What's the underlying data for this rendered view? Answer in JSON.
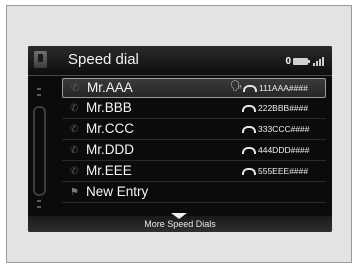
{
  "header": {
    "title": "Speed dial",
    "status_number": "0",
    "phone_icon": "phone-tab-icon",
    "battery_icon": "battery-icon",
    "signal_icon": "signal-icon"
  },
  "entries": [
    {
      "name": "Mr.AAA",
      "number": "111AAA####",
      "voice_tag": true
    },
    {
      "name": "Mr.BBB",
      "number": "222BBB####",
      "voice_tag": false
    },
    {
      "name": "Mr.CCC",
      "number": "333CCC####",
      "voice_tag": false
    },
    {
      "name": "Mr.DDD",
      "number": "444DDD####",
      "voice_tag": false
    },
    {
      "name": "Mr.EEE",
      "number": "555EEE####",
      "voice_tag": false
    }
  ],
  "new_entry_label": "New Entry",
  "more_label": "More Speed Dials",
  "voice_tag_glyph": "ℙ",
  "colors": {
    "screen_bg": "#0b0b0b",
    "text": "#f4f4f4",
    "panel_bg": "#e3e3e3"
  }
}
